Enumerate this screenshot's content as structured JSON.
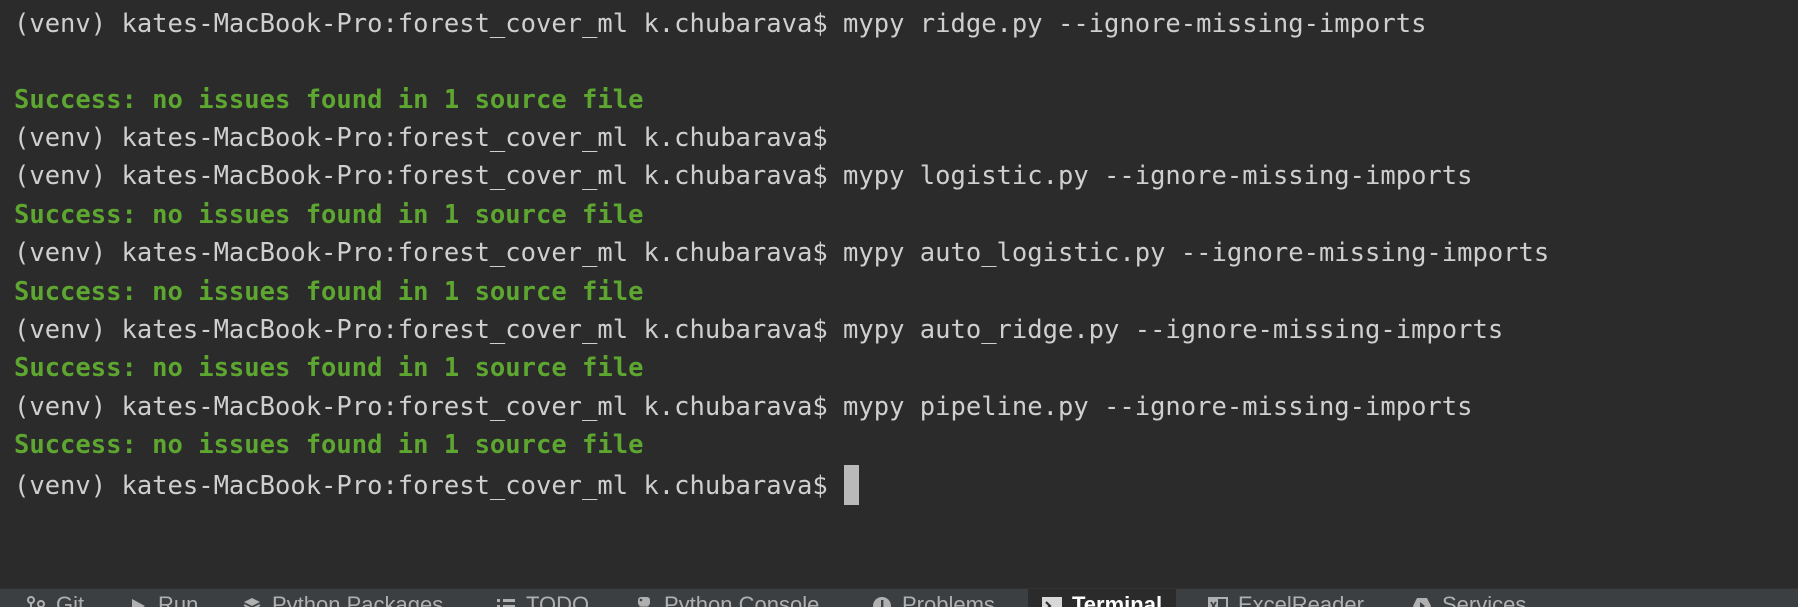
{
  "terminal": {
    "lines": [
      {
        "prompt": "(venv) kates-MacBook-Pro:forest_cover_ml k.chubarava$",
        "command": "mypy ridge.py --ignore-missing-imports"
      },
      {
        "success": "Success: no issues found in 1 source file"
      },
      {
        "prompt": "(venv) kates-MacBook-Pro:forest_cover_ml k.chubarava$"
      },
      {
        "prompt": "(venv) kates-MacBook-Pro:forest_cover_ml k.chubarava$",
        "command": "mypy logistic.py --ignore-missing-imports"
      },
      {
        "success": "Success: no issues found in 1 source file"
      },
      {
        "prompt": "(venv) kates-MacBook-Pro:forest_cover_ml k.chubarava$",
        "command": "mypy auto_logistic.py --ignore-missing-imports"
      },
      {
        "success": "Success: no issues found in 1 source file"
      },
      {
        "prompt": "(venv) kates-MacBook-Pro:forest_cover_ml k.chubarava$",
        "command": "mypy auto_ridge.py --ignore-missing-imports"
      },
      {
        "success": "Success: no issues found in 1 source file"
      },
      {
        "prompt": "(venv) kates-MacBook-Pro:forest_cover_ml k.chubarava$",
        "command": "mypy pipeline.py --ignore-missing-imports"
      },
      {
        "success": "Success: no issues found in 1 source file"
      },
      {
        "prompt": "(venv) kates-MacBook-Pro:forest_cover_ml k.chubarava$"
      }
    ],
    "colors": {
      "background": "#2b2b2b",
      "text": "#cfcfcf",
      "success": "#5da630",
      "cursor": "#b9b9b9"
    }
  },
  "toolbar": {
    "tabs": [
      {
        "label": "Git",
        "icon": "git-branch-icon"
      },
      {
        "label": "Run",
        "icon": "run-icon"
      },
      {
        "label": "Python Packages",
        "icon": "packages-icon"
      },
      {
        "label": "TODO",
        "icon": "todo-list-icon"
      },
      {
        "label": "Python Console",
        "icon": "python-console-icon"
      },
      {
        "label": "Problems",
        "icon": "problems-icon"
      },
      {
        "label": "Terminal",
        "icon": "terminal-icon",
        "active": true
      },
      {
        "label": "ExcelReader",
        "icon": "excel-icon"
      },
      {
        "label": "Services",
        "icon": "services-icon"
      }
    ]
  }
}
